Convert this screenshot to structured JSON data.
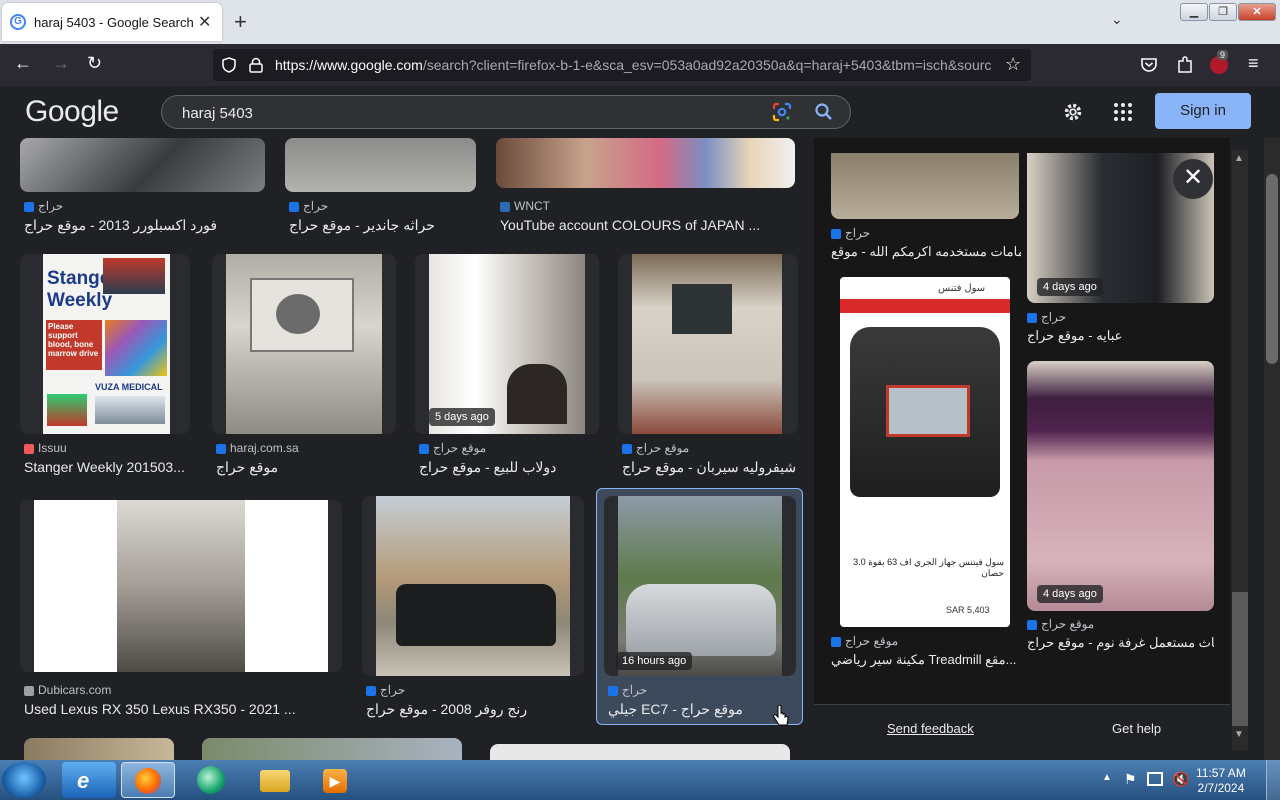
{
  "browser": {
    "tab_title": "haraj 5403 - Google Search",
    "url_host": "https://www.google.com",
    "url_rest": "/search?client=firefox-b-1-e&sca_esv=053a0ad92a20350a&q=haraj+5403&tbm=isch&sourc",
    "extension_badge": "9"
  },
  "google": {
    "logo": "Google",
    "query": "haraj 5403",
    "sign_in": "Sign in"
  },
  "results": {
    "row0": [
      {
        "source": "حراج",
        "caption": "فورد اكسبلورر 2013 - موقع حراج"
      },
      {
        "source": "حراج",
        "caption": "حراثه جاندير - موقع حراج"
      },
      {
        "source": "WNCT",
        "caption": "YouTube account COLOURS of JAPAN ..."
      }
    ],
    "row1": [
      {
        "source": "Issuu",
        "caption": "Stanger Weekly 201503...",
        "poster_title": "Stanger Weekly",
        "poster_text": "Please support blood, bone marrow drive",
        "poster_footer": "VUZA MEDICAL"
      },
      {
        "source": "haraj.com.sa",
        "caption": "موقع حراج"
      },
      {
        "source": "موقع حراج",
        "caption": "دولاب للبيع - موقع حراج",
        "badge": "5 days ago"
      },
      {
        "source": "موقع حراج",
        "caption": "شيفروليه سيربان - موقع حراج"
      }
    ],
    "row2": [
      {
        "source": "Dubicars.com",
        "caption": "Used Lexus RX 350 Lexus RX350 - 2021 ..."
      },
      {
        "source": "حراج",
        "caption": "رنج روفر 2008 - موقع حراج"
      },
      {
        "source": "حراج",
        "caption": "جيلي EC7 - موقع حراج",
        "badge": "16 hours ago"
      }
    ]
  },
  "panel": {
    "col1": [
      {
        "source": "حراج",
        "caption": "حمامات مستخدمه اكرمكم الله - موقع ..."
      },
      {
        "source": "موقع حراج",
        "caption": "مكينة سير رياضي Treadmill مقع...",
        "price": "SAR 5,403",
        "title_text": "سول فيتنس جهاز الجري اف 63 بقوة 3.0 حصان",
        "header_text": "سول فتنس"
      }
    ],
    "col2": [
      {
        "source": "حراج",
        "caption": "عبايه - موقع حراج",
        "badge": "4 days ago"
      },
      {
        "source": "موقع حراج",
        "caption": "اثاث مستعمل غرفة نوم - موقع حراج",
        "badge": "4 days ago"
      }
    ],
    "feedback": "Send feedback",
    "help": "Get help"
  },
  "taskbar": {
    "time": "11:57 AM",
    "date": "2/7/2024"
  },
  "colors": {
    "background": "#202124",
    "accent": "#8ab4f8",
    "haraj_blue": "#1a73e8"
  }
}
